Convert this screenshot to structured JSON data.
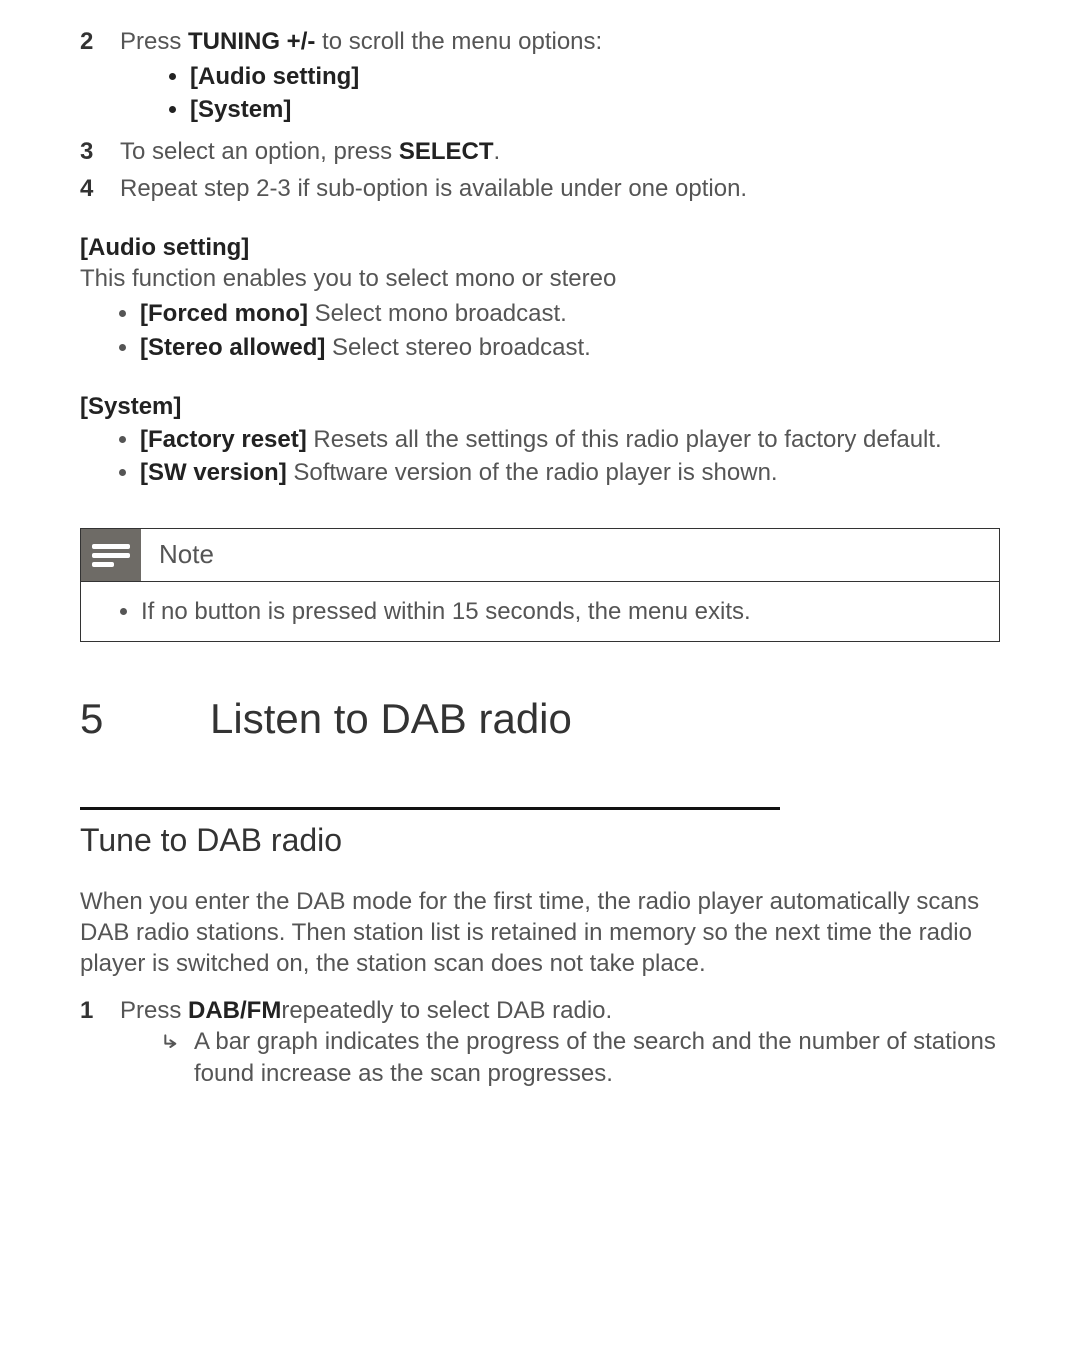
{
  "steps": {
    "s2_pre": "Press ",
    "s2_bold": "TUNING +/-",
    "s2_post": " to scroll the menu options:",
    "s2_bullets": [
      "[Audio setting]",
      "[System]"
    ],
    "s3_pre": "To select an option, press ",
    "s3_bold": "SELECT",
    "s3_post": ".",
    "s4": "Repeat step 2-3 if sub-option is available under one option."
  },
  "audio": {
    "heading": "[Audio setting]",
    "desc": "This function enables you to select mono or stereo",
    "items": [
      {
        "bold": "[Forced mono]",
        "rest": " Select mono broadcast."
      },
      {
        "bold": "[Stereo allowed]",
        "rest": " Select stereo broadcast."
      }
    ]
  },
  "system": {
    "heading": "[System]",
    "items": [
      {
        "bold": "[Factory reset]",
        "rest": "  Resets all the settings of this radio player to factory default."
      },
      {
        "bold": "[SW version]",
        "rest": "  Software version of the radio player is shown."
      }
    ]
  },
  "note": {
    "title": "Note",
    "body": "If no button is pressed within 15 seconds, the menu exits."
  },
  "chapter": {
    "num": "5",
    "title": "Listen to DAB radio"
  },
  "section": {
    "heading": "Tune to DAB radio",
    "para": "When you enter the DAB mode for the first time, the radio player automatically scans DAB radio stations. Then station list is retained in memory so the next time the radio player is switched on, the station scan does not take place.",
    "d1_pre": "Press ",
    "d1_bold": "DAB/FM",
    "d1_post": "repeatedly to select DAB radio.",
    "d1_result": "A bar graph indicates the progress of the search and the number of stations found increase as the scan progresses."
  }
}
